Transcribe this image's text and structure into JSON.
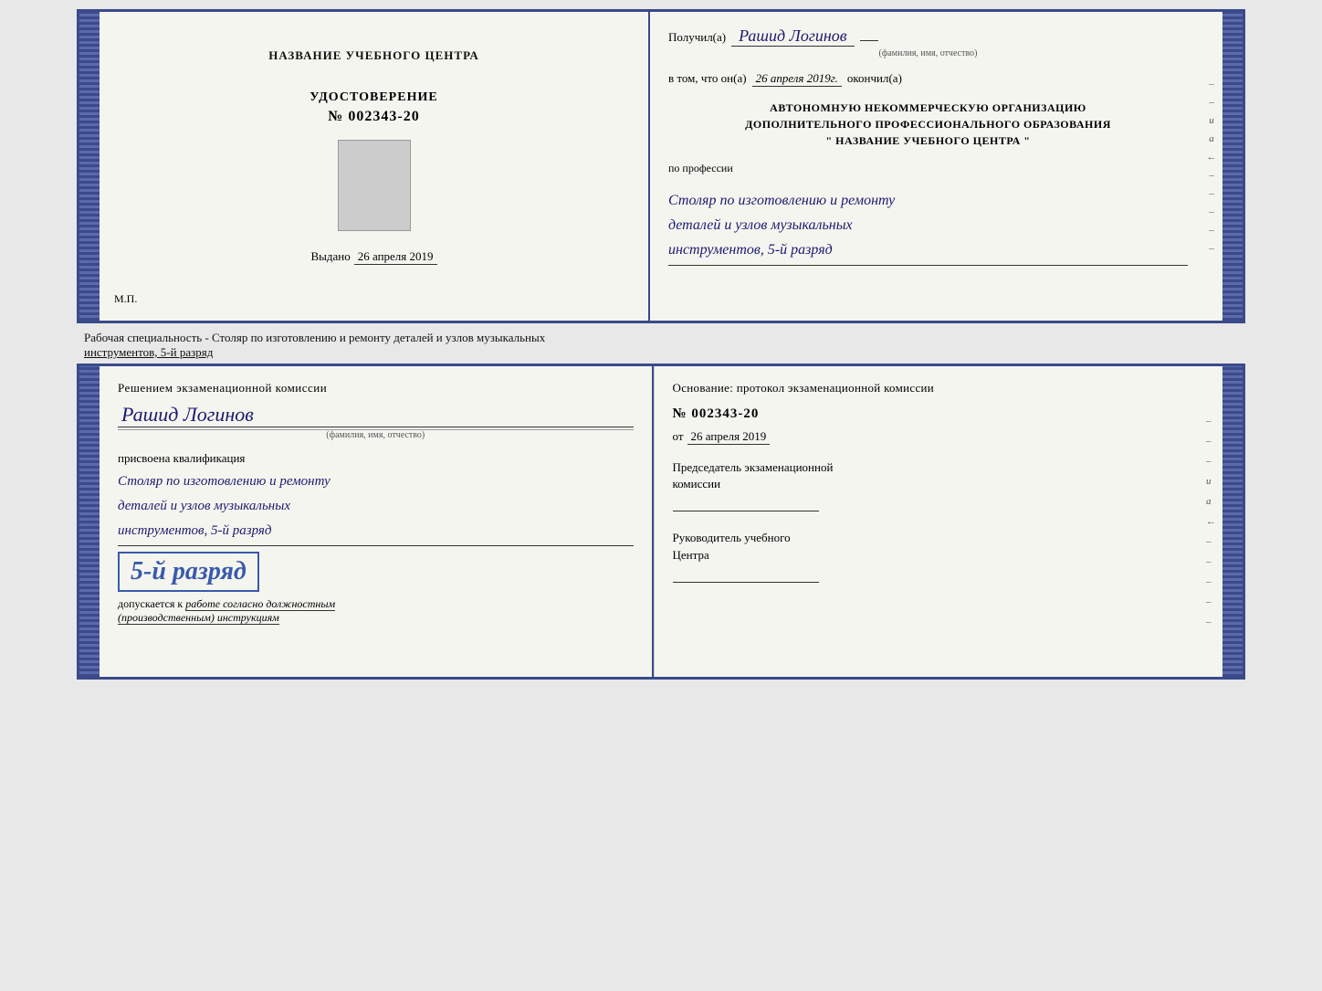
{
  "top_doc": {
    "left": {
      "title": "НАЗВАНИЕ УЧЕБНОГО ЦЕНТРА",
      "udostoverenie_label": "УДОСТОВЕРЕНИЕ",
      "number": "№ 002343-20",
      "vydano_label": "Выдано",
      "vydano_date": "26 апреля 2019",
      "mp_label": "М.П."
    },
    "right": {
      "poluchil_label": "Получил(а)",
      "poluchil_name": "Рашид Логинов",
      "fio_sub": "(фамилия, имя, отчество)",
      "vtom_label": "в том, что он(а)",
      "vtom_date": "26 апреля 2019г.",
      "okonchil_label": "окончил(а)",
      "org_line1": "АВТОНОМНУЮ НЕКОММЕРЧЕСКУЮ ОРГАНИЗАЦИЮ",
      "org_line2": "ДОПОЛНИТЕЛЬНОГО ПРОФЕССИОНАЛЬНОГО ОБРАЗОВАНИЯ",
      "org_line3": "\"  НАЗВАНИЕ УЧЕБНОГО ЦЕНТРА  \"",
      "po_professii": "по профессии",
      "profession1": "Столяр по изготовлению и ремонту",
      "profession2": "деталей и узлов музыкальных",
      "profession3": "инструментов, 5-й разряд"
    }
  },
  "middle_label": {
    "text_normal": "Рабочая специальность - Столяр по изготовлению и ремонту деталей и узлов музыкальных",
    "text_underline": "инструментов, 5-й разряд"
  },
  "bottom_doc": {
    "left": {
      "resheniem_label": "Решением экзаменационной комиссии",
      "name": "Рашид Логинов",
      "fio_sub": "(фамилия, имя, отчество)",
      "prisvoena_label": "присвоена квалификация",
      "qualification1": "Столяр по изготовлению и ремонту",
      "qualification2": "деталей и узлов музыкальных",
      "qualification3": "инструментов, 5-й разряд",
      "razryad_highlight": "5-й разряд",
      "dopuskaetsya_label": "допускается к",
      "dopuskaetsya_value": "работе согласно должностным",
      "dopuskaetsya_value2": "(производственным) инструкциям"
    },
    "right": {
      "osnovanie_label": "Основание: протокол экзаменационной комиссии",
      "protocol_number": "№  002343-20",
      "ot_label": "от",
      "ot_date": "26 апреля 2019",
      "predsedatel_line1": "Председатель экзаменационной",
      "predsedatel_line2": "комиссии",
      "rukovoditel_line1": "Руководитель учебного",
      "rukovoditel_line2": "Центра"
    },
    "right_side_chars": [
      "–",
      "–",
      "–",
      "и",
      "а",
      "←",
      "–",
      "–",
      "–",
      "–",
      "–"
    ]
  }
}
